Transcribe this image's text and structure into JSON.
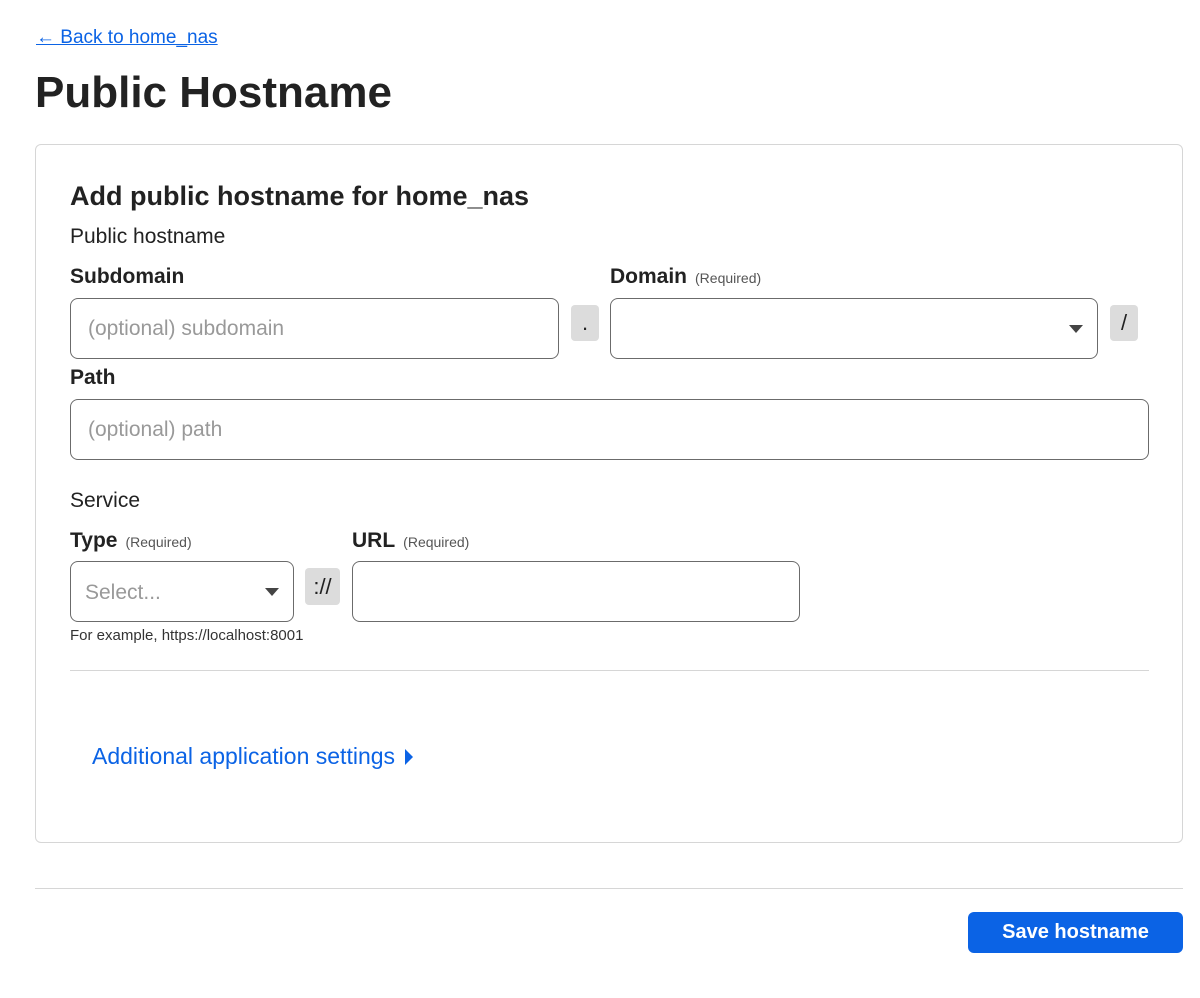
{
  "nav": {
    "back_label": "← Back to home_nas"
  },
  "page": {
    "title": "Public Hostname"
  },
  "form": {
    "title": "Add public hostname for home_nas",
    "hostname_section": "Public hostname",
    "subdomain": {
      "label": "Subdomain",
      "placeholder": "(optional) subdomain",
      "value": ""
    },
    "dot_separator": ".",
    "domain": {
      "label": "Domain",
      "required": "(Required)",
      "value": ""
    },
    "slash_separator": "/",
    "path": {
      "label": "Path",
      "placeholder": "(optional) path",
      "value": ""
    },
    "service_section": "Service",
    "type": {
      "label": "Type",
      "required": "(Required)",
      "placeholder": "Select..."
    },
    "scheme_separator": "://",
    "url": {
      "label": "URL",
      "required": "(Required)",
      "value": ""
    },
    "url_hint": "For example, https://localhost:8001",
    "additional_settings": "Additional application settings"
  },
  "footer": {
    "save_label": "Save hostname"
  },
  "colors": {
    "accent": "#0b63e5",
    "border": "#6b6b6b",
    "separator_bg": "#dcdcdc"
  },
  "icons": {
    "caret": "caret-down-icon",
    "expand": "caret-right-icon"
  }
}
